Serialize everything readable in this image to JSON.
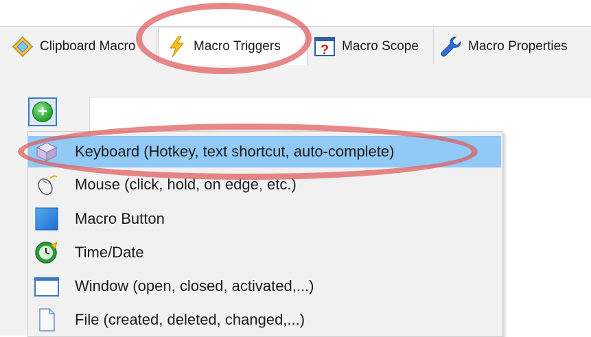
{
  "tabs": [
    {
      "label": "Clipboard Macro",
      "icon": "clipboard-diamond-icon",
      "active": false
    },
    {
      "label": "Macro Triggers",
      "icon": "lightning-bolt-icon",
      "active": true
    },
    {
      "label": "Macro Scope",
      "icon": "question-mark-icon",
      "active": false
    },
    {
      "label": "Macro Properties",
      "icon": "wrench-icon",
      "active": false
    }
  ],
  "add_button": {
    "icon": "green-plus-icon"
  },
  "menu": {
    "items": [
      {
        "label": "Keyboard (Hotkey, text shortcut, auto-complete)",
        "icon": "keyboard-key-icon",
        "highlighted": true
      },
      {
        "label": "Mouse (click, hold, on edge, etc.)",
        "icon": "mouse-icon",
        "highlighted": false
      },
      {
        "label": "Macro Button",
        "icon": "blue-square-icon",
        "highlighted": false
      },
      {
        "label": "Time/Date",
        "icon": "clock-icon",
        "highlighted": false
      },
      {
        "label": "Window (open, closed, activated,...)",
        "icon": "window-icon",
        "highlighted": false
      },
      {
        "label": "File (created, deleted, changed,...)",
        "icon": "file-icon",
        "highlighted": false
      }
    ]
  },
  "colors": {
    "menu_highlight": "#91c9f7",
    "annotation_red": "#e05a5a",
    "tab_strip": "#f2f2f2"
  }
}
